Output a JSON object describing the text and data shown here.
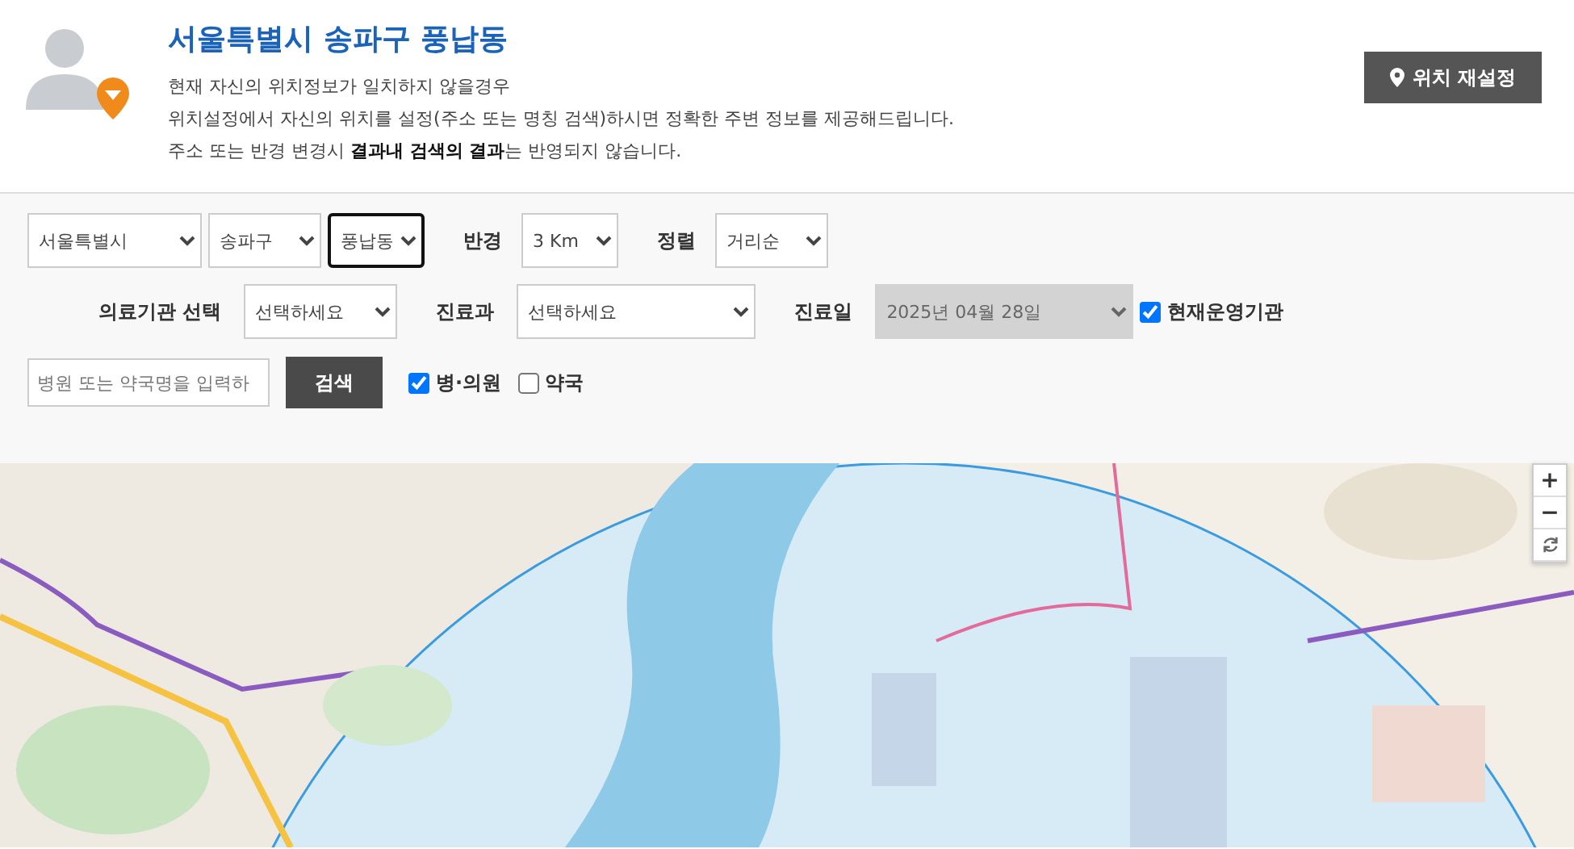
{
  "header": {
    "title": "서울특별시 송파구 풍납동",
    "lines": [
      "현재 자신의 위치정보가 일치하지 않을경우",
      "위치설정에서 자신의 위치를 설정(주소 또는 명칭 검색)하시면 정확한 주변 정보를 제공해드립니다.",
      "주소 또는 반경 변경시 **결과내 검색의 결과**는 반영되지 않습니다."
    ],
    "reset_button": "위치 재설정"
  },
  "filters": {
    "row1": [
      {
        "kind": "select",
        "value": "서울특별시",
        "focused": false
      },
      {
        "kind": "select",
        "value": "송파구",
        "focused": false
      },
      {
        "kind": "select",
        "value": "풍납동",
        "focused": true
      },
      {
        "kind": "label",
        "text": "반경"
      },
      {
        "kind": "select",
        "value": "3 Km",
        "focused": false
      },
      {
        "kind": "label",
        "text": "정렬"
      },
      {
        "kind": "select",
        "value": "거리순",
        "focused": false
      }
    ],
    "row2": [
      {
        "kind": "label",
        "text": "의료기관 선택"
      },
      {
        "kind": "select",
        "value": "선택하세요",
        "focused": false
      },
      {
        "kind": "label",
        "text": "진료과"
      },
      {
        "kind": "select",
        "value": "선택하세요",
        "focused": false
      },
      {
        "kind": "label",
        "text": "진료일"
      },
      {
        "kind": "select",
        "value": "2025년 04월 28일",
        "disabled": true,
        "focused": false
      },
      {
        "kind": "checkbox",
        "text": "현재운영기관",
        "checked": true
      }
    ],
    "search": {
      "placeholder": "병원 또는 약국명을 입력하",
      "button": "검색"
    },
    "types": [
      {
        "text": "병·의원",
        "checked": true
      },
      {
        "text": "약국",
        "checked": false
      }
    ]
  },
  "map": {
    "kind": "picture",
    "zoom_in": "+",
    "zoom_out": "−"
  }
}
